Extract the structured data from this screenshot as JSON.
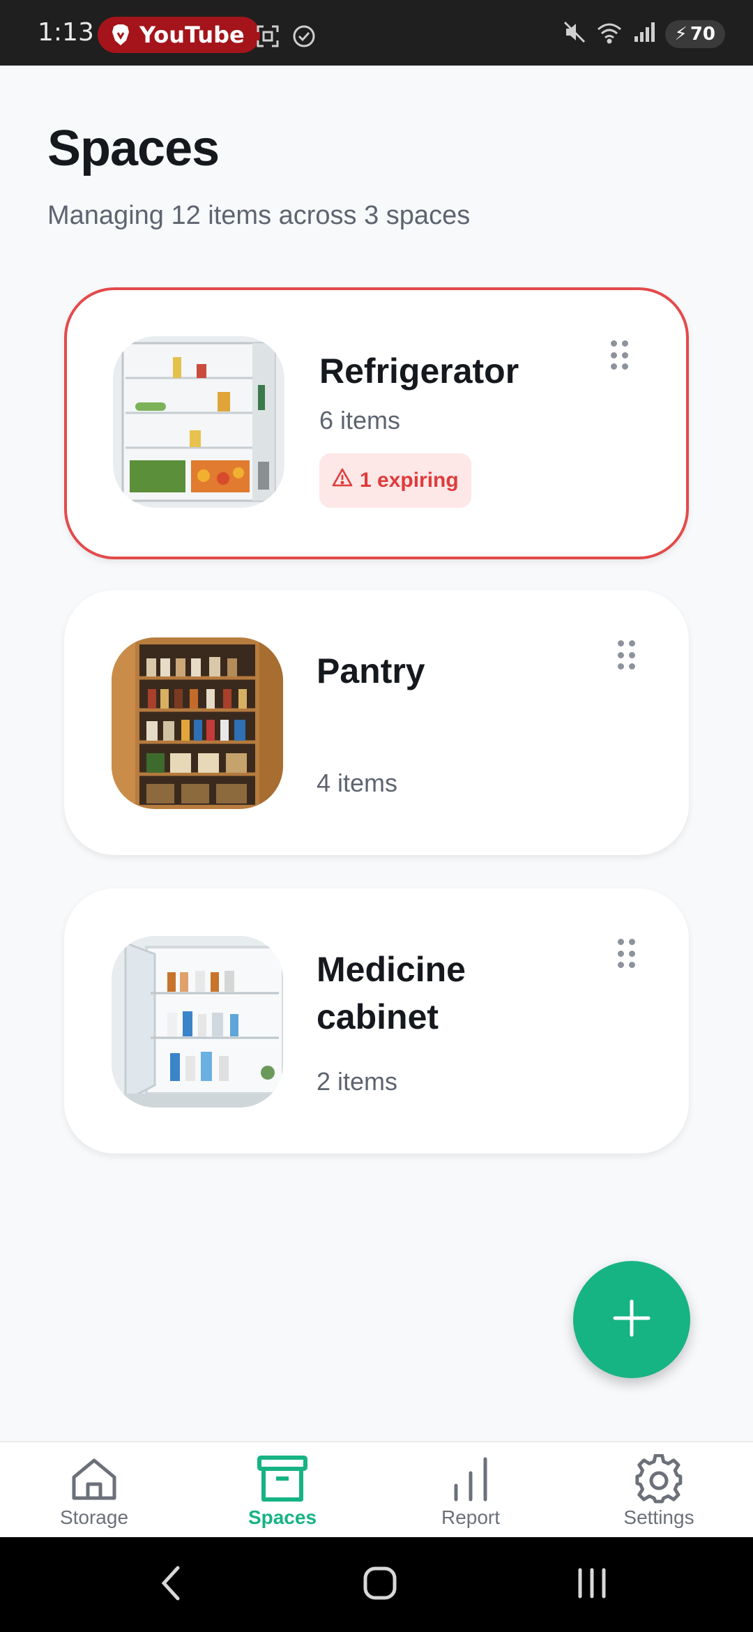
{
  "status_bar": {
    "time": "1:13",
    "pill_app": "YouTube",
    "battery": "70"
  },
  "header": {
    "title": "Spaces",
    "subtitle": "Managing 12 items across 3 spaces"
  },
  "spaces": [
    {
      "name": "Refrigerator",
      "count": "6 items",
      "badge": "1 expiring",
      "expiring": true,
      "thumb": "refrigerator-photo"
    },
    {
      "name": "Pantry",
      "count": "4 items",
      "expiring": false,
      "thumb": "pantry-photo"
    },
    {
      "name": "Medicine cabinet",
      "count": "2 items",
      "expiring": false,
      "thumb": "medicine-cabinet-photo"
    }
  ],
  "nav": {
    "items": [
      {
        "label": "Storage",
        "icon": "home-icon"
      },
      {
        "label": "Spaces",
        "icon": "archive-box-icon",
        "active": true
      },
      {
        "label": "Report",
        "icon": "bar-chart-icon"
      },
      {
        "label": "Settings",
        "icon": "gear-icon"
      }
    ]
  },
  "colors": {
    "accent": "#16b383",
    "alert": "#e34a4a",
    "alert_bg": "#fde7e7"
  }
}
